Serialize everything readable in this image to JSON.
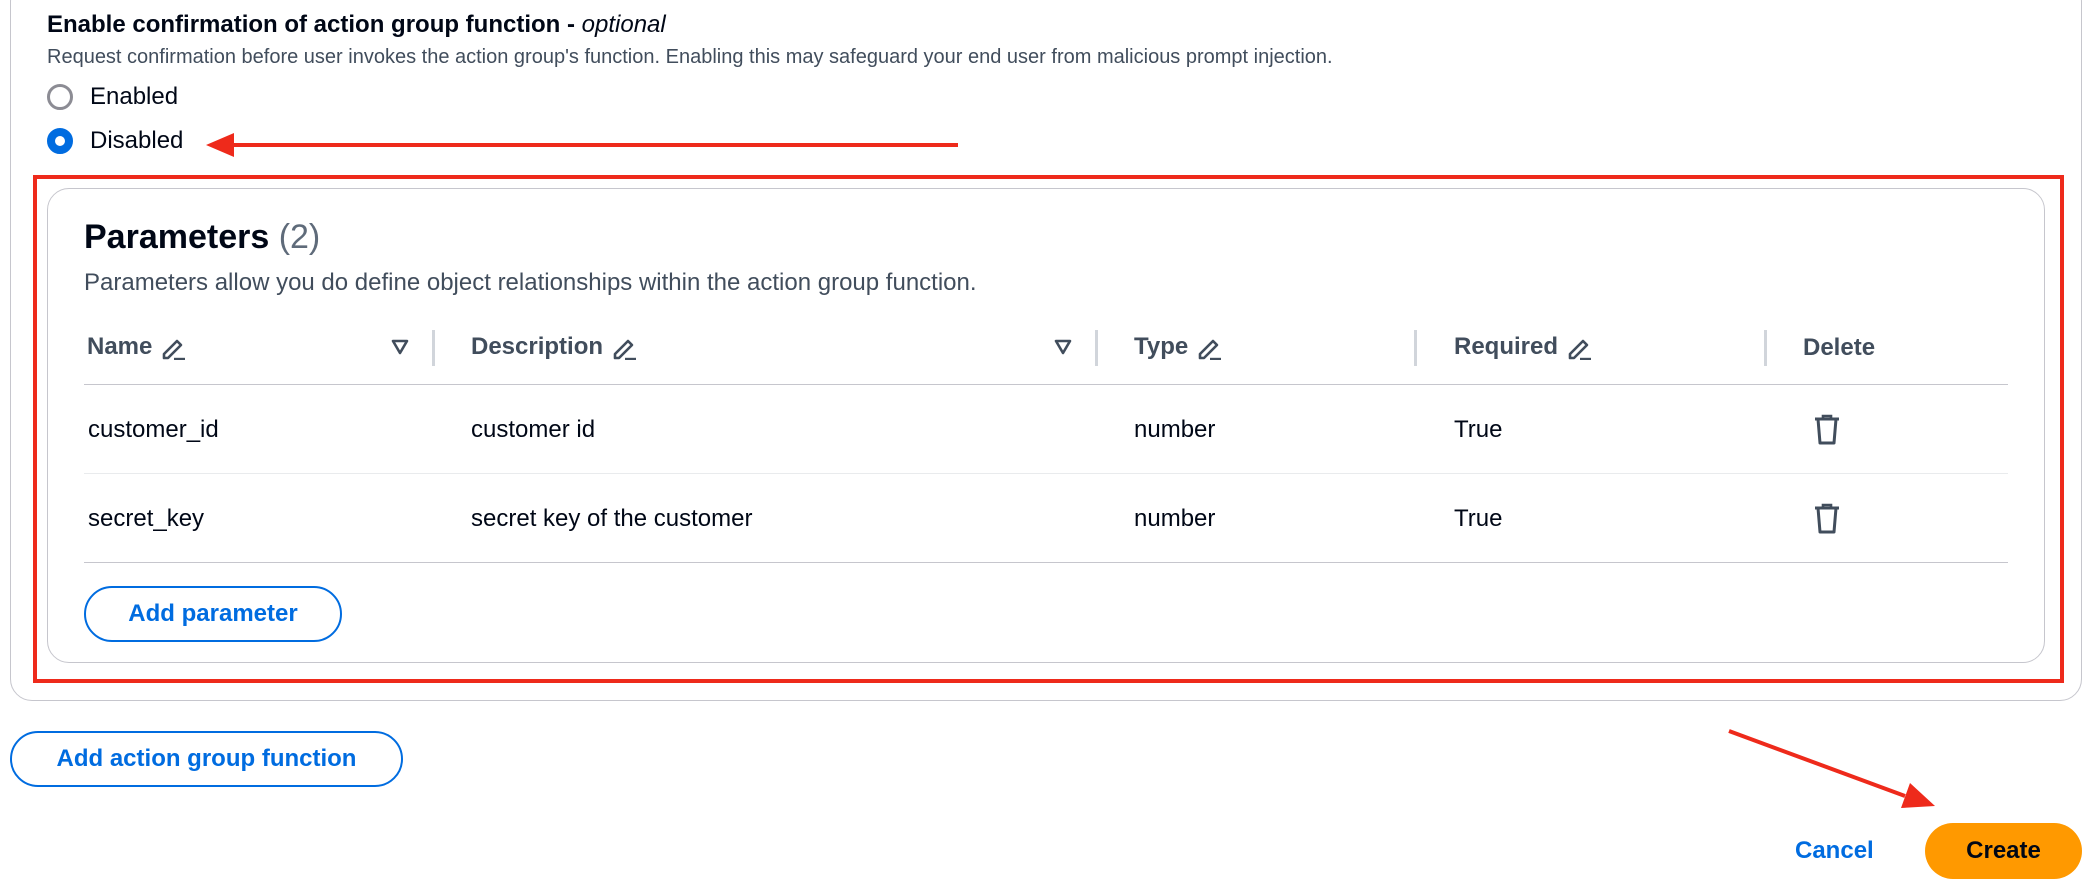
{
  "confirmation": {
    "title": "Enable confirmation of action group function - ",
    "optional": "optional",
    "description": "Request confirmation before user invokes the action group's function. Enabling this may safeguard your end user from malicious prompt injection.",
    "options": [
      {
        "label": "Enabled",
        "selected": false
      },
      {
        "label": "Disabled",
        "selected": true
      }
    ]
  },
  "parameters": {
    "title": "Parameters",
    "count": "(2)",
    "description": "Parameters allow you do define object relationships within the action group function.",
    "columns": [
      "Name",
      "Description",
      "Type",
      "Required",
      "Delete"
    ],
    "rows": [
      {
        "name": "customer_id",
        "description": "customer id",
        "type": "number",
        "required": "True"
      },
      {
        "name": "secret_key",
        "description": "secret key of the customer",
        "type": "number",
        "required": "True"
      }
    ],
    "add_button": "Add parameter"
  },
  "actions": {
    "add_function": "Add action group function",
    "cancel": "Cancel",
    "create": "Create"
  },
  "colors": {
    "accent": "#006ce0",
    "primary_button": "#ff9900",
    "annotation": "#ee2a1b"
  },
  "icons": [
    "edit-pencil-icon",
    "sort-triangle-icon",
    "trash-icon",
    "radio-icon",
    "arrow-annotation"
  ]
}
